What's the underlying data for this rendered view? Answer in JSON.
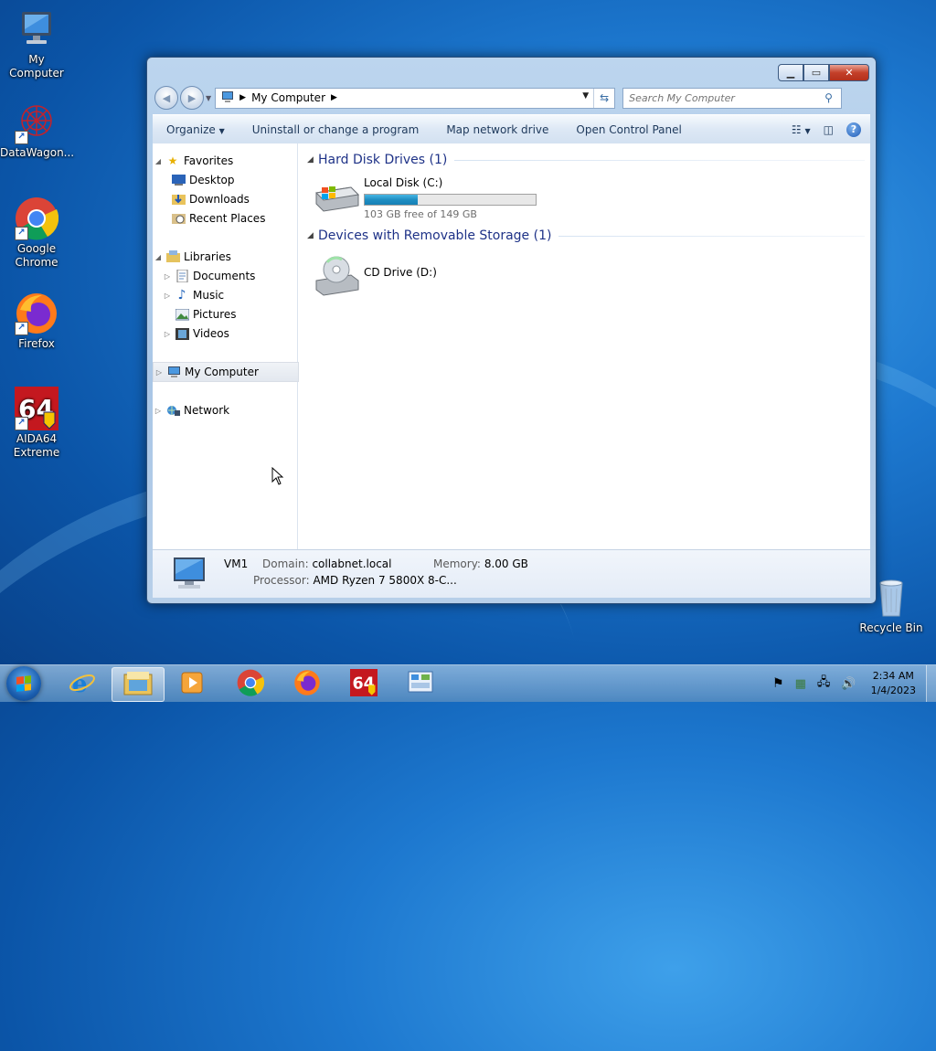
{
  "desktop": {
    "icons": [
      {
        "label": "My Computer"
      },
      {
        "label": "DataWagon..."
      },
      {
        "label": "Google Chrome"
      },
      {
        "label": "Firefox"
      },
      {
        "label": "AIDA64 Extreme"
      },
      {
        "label": "Recycle Bin"
      }
    ]
  },
  "window": {
    "address": {
      "crumb": "My Computer"
    },
    "search_placeholder": "Search My Computer",
    "toolbar": {
      "organize": "Organize",
      "uninstall": "Uninstall or change a program",
      "map_drive": "Map network drive",
      "control_panel": "Open Control Panel"
    },
    "nav": {
      "favorites": "Favorites",
      "desktop": "Desktop",
      "downloads": "Downloads",
      "recent": "Recent Places",
      "libraries": "Libraries",
      "documents": "Documents",
      "music": "Music",
      "pictures": "Pictures",
      "videos": "Videos",
      "computer": "My Computer",
      "network": "Network"
    },
    "groups": {
      "hdd": "Hard Disk Drives (1)",
      "removable": "Devices with Removable Storage (1)"
    },
    "drives": {
      "c": {
        "name": "Local Disk (C:)",
        "free": "103 GB free of 149 GB",
        "used_fraction": 0.31
      },
      "d": {
        "name": "CD Drive (D:)"
      }
    },
    "details": {
      "name": "VM1",
      "domain_label": "Domain:",
      "domain": "collabnet.local",
      "memory_label": "Memory:",
      "memory": "8.00 GB",
      "processor_label": "Processor:",
      "processor": "AMD Ryzen 7 5800X 8-C..."
    }
  },
  "taskbar": {
    "time": "2:34 AM",
    "date": "1/4/2023"
  },
  "colors": {
    "accent": "#1e3287",
    "link": "#1e395b",
    "progress": "#1f8ec2"
  }
}
